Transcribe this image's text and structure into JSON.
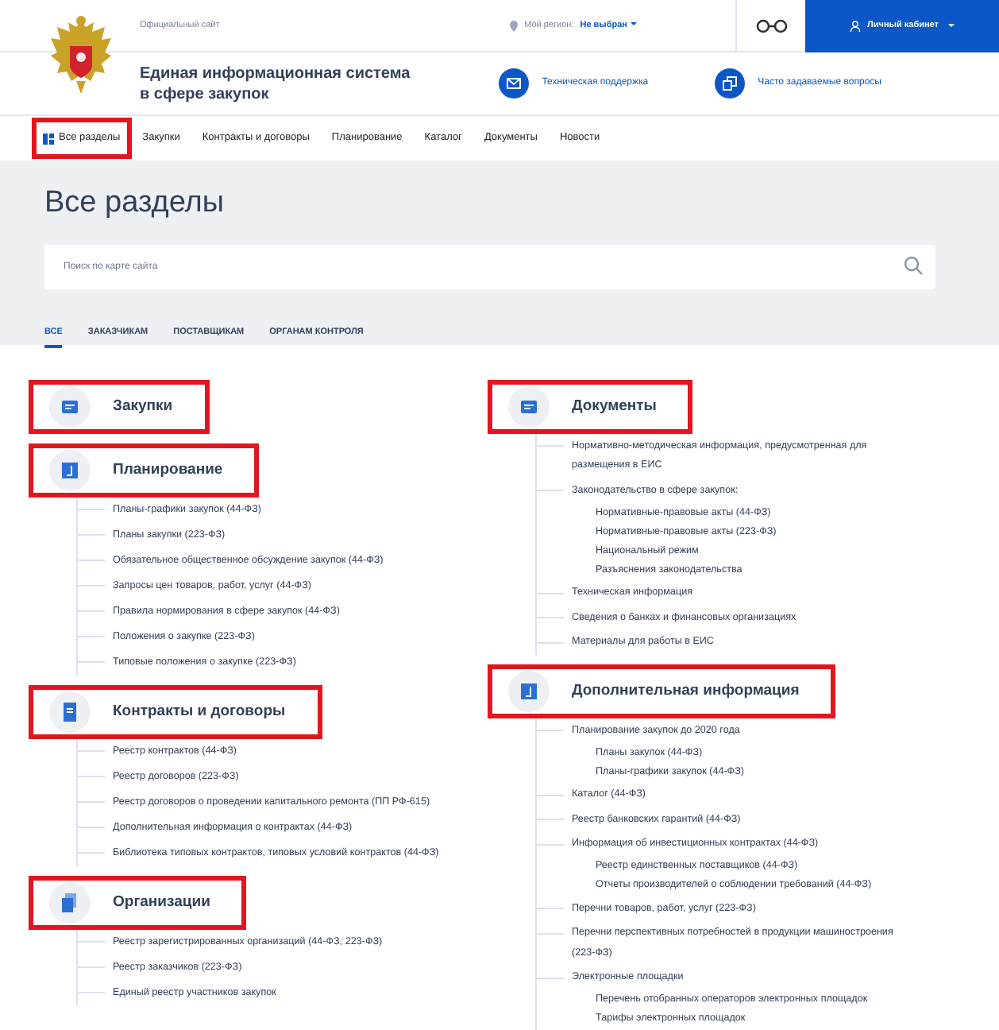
{
  "top_bar": {
    "official": "Официальный сайт",
    "region_label": "Мой регион:",
    "region_value": "Не выбран",
    "account_button": "Личный кабинет"
  },
  "header": {
    "title_lines": [
      "Единая информационная система",
      "в сфере закупок"
    ],
    "links": [
      "Техническая поддержка",
      "Часто задаваемые вопросы"
    ]
  },
  "nav": [
    {
      "label": "Все разделы",
      "highlighted": true
    },
    {
      "label": "Закупки",
      "highlighted": false
    },
    {
      "label": "Контракты и договоры",
      "highlighted": false
    },
    {
      "label": "Планирование",
      "highlighted": false
    },
    {
      "label": "Каталог",
      "highlighted": false
    },
    {
      "label": "Документы",
      "highlighted": false
    },
    {
      "label": "Новости",
      "highlighted": false
    }
  ],
  "page_title": "Все разделы",
  "search": {
    "placeholder": "Поиск по карте сайта"
  },
  "tabs": [
    {
      "label": "ВСЕ",
      "selected": true
    },
    {
      "label": "ЗАКАЗЧИКАМ",
      "selected": false
    },
    {
      "label": "ПОСТАВЩИКАМ",
      "selected": false
    },
    {
      "label": "ОРГАНАМ КОНТРОЛЯ",
      "selected": false
    }
  ],
  "columns": [
    [
      {
        "title": "Закупки",
        "highlighted": true
      },
      {
        "title": "Планирование",
        "highlighted": true,
        "items": [
          {
            "label": "Планы-графики закупок (44-ФЗ)"
          },
          {
            "label": "Планы закупки (223-ФЗ)"
          },
          {
            "label": "Обязательное общественное обсуждение закупок (44-ФЗ)"
          },
          {
            "label": "Запросы цен товаров, работ, услуг (44-ФЗ)"
          },
          {
            "label": "Правила нормирования в сфере закупок (44-ФЗ)"
          },
          {
            "label": "Положения о закупке (223-ФЗ)"
          },
          {
            "label": "Типовые положения о закупке (223-ФЗ)"
          }
        ]
      },
      {
        "title": "Контракты и договоры",
        "highlighted": true,
        "items": [
          {
            "label": "Реестр контрактов (44-ФЗ)"
          },
          {
            "label": "Реестр договоров (223-ФЗ)"
          },
          {
            "label": "Реестр договоров о проведении капитального ремонта (ПП РФ-615)"
          },
          {
            "label": "Дополнительная информация о контрактах (44-ФЗ)"
          },
          {
            "label": "Библиотека типовых контрактов, типовых условий контрактов (44-ФЗ)"
          }
        ]
      },
      {
        "title": "Организации",
        "highlighted": true,
        "items": [
          {
            "label": "Реестр зарегистрированных организаций (44-ФЗ, 223-ФЗ)"
          },
          {
            "label": "Реестр заказчиков (223-ФЗ)"
          },
          {
            "label": "Единый реестр участников закупок"
          }
        ]
      }
    ],
    [
      {
        "title": "Документы",
        "highlighted": true,
        "items": [
          {
            "label": "Нормативно-методическая информация, предусмотренная для размещения в ЕИС"
          },
          {
            "label": "Законодательство в сфере закупок:",
            "children": [
              {
                "label": "Нормативные-правовые акты (44-ФЗ)"
              },
              {
                "label": "Нормативные-правовые акты (223-ФЗ)"
              },
              {
                "label": "Национальный режим"
              },
              {
                "label": "Разъяснения законодательства"
              }
            ]
          },
          {
            "label": "Техническая информация"
          },
          {
            "label": "Сведения о банках и финансовых организациях"
          },
          {
            "label": "Материалы для работы в ЕИС"
          }
        ]
      },
      {
        "title": "Дополнительная информация",
        "highlighted": true,
        "items": [
          {
            "label": "Планирование закупок до 2020 года",
            "children": [
              {
                "label": "Планы закупок (44-ФЗ)"
              },
              {
                "label": "Планы-графики закупок (44-ФЗ)"
              }
            ]
          },
          {
            "label": "Каталог (44-ФЗ)"
          },
          {
            "label": "Реестр банковских гарантий (44-ФЗ)"
          },
          {
            "label": "Информация об инвестиционных контрактах (44-ФЗ)",
            "children": [
              {
                "label": "Реестр единственных поставщиков (44-ФЗ)"
              },
              {
                "label": "Отчеты производителей о соблюдении требований (44-ФЗ)"
              }
            ]
          },
          {
            "label": "Перечни товаров, работ, услуг (223-ФЗ)"
          },
          {
            "label": "Перечни перспективных потребностей в продукции машиностроения (223-ФЗ)"
          },
          {
            "label": "Электронные площадки",
            "children": [
              {
                "label": "Перечень отобранных операторов электронных площадок"
              },
              {
                "label": "Тарифы электронных площадок"
              }
            ]
          }
        ]
      }
    ]
  ]
}
